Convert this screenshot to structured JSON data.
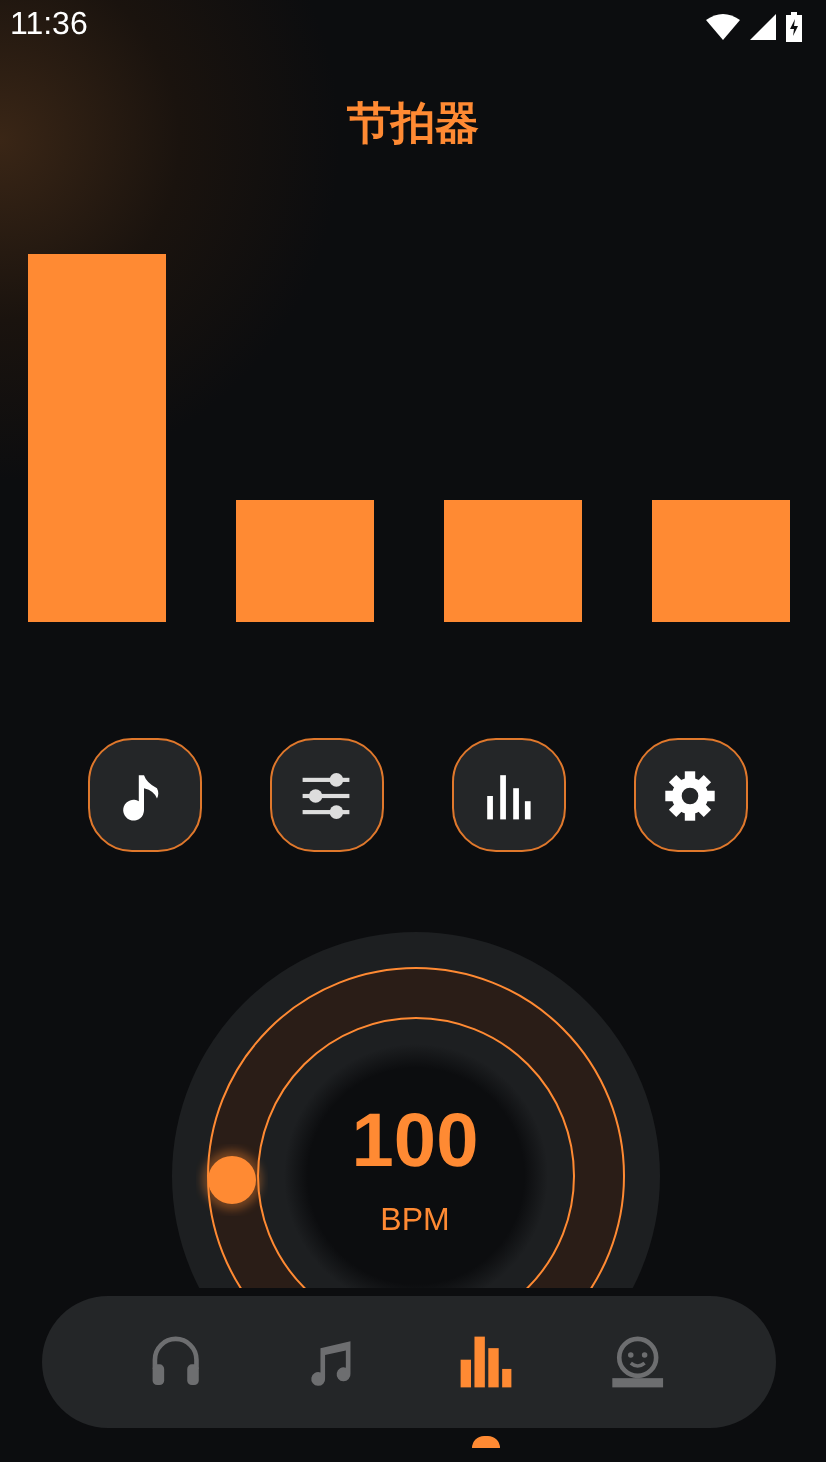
{
  "status_bar": {
    "time": "11:36"
  },
  "title": "节拍器",
  "beats": [
    {
      "accent": true
    },
    {
      "accent": false
    },
    {
      "accent": false
    },
    {
      "accent": false
    }
  ],
  "tools": [
    {
      "kind": "note"
    },
    {
      "kind": "sliders"
    },
    {
      "kind": "bars"
    },
    {
      "kind": "gear"
    }
  ],
  "dial": {
    "value": "100",
    "unit": "BPM"
  },
  "nav": [
    {
      "kind": "headphones",
      "selected": false
    },
    {
      "kind": "music",
      "selected": false
    },
    {
      "kind": "bars",
      "selected": true
    },
    {
      "kind": "robot",
      "selected": false
    }
  ]
}
